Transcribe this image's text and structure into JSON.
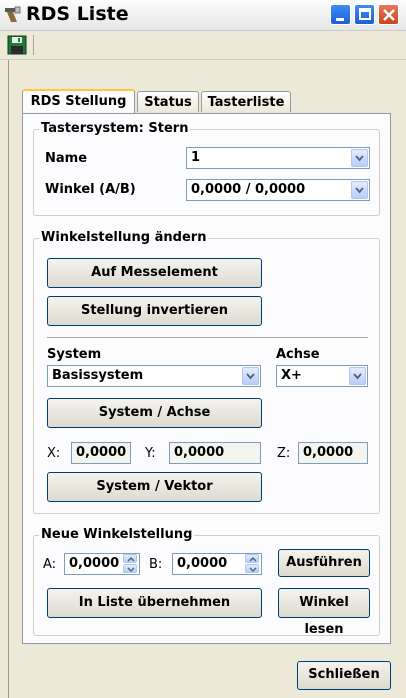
{
  "window": {
    "title": "RDS Liste"
  },
  "tabs": [
    {
      "label": "RDS Stellung",
      "active": true
    },
    {
      "label": "Status",
      "active": false
    },
    {
      "label": "Tasterliste",
      "active": false
    }
  ],
  "tastersystem": {
    "title": "Tastersystem: Stern",
    "name_label": "Name",
    "name_value": "1",
    "winkel_label": "Winkel (A/B)",
    "winkel_value": "0,0000 / 0,0000"
  },
  "winkelstellung": {
    "title": "Winkelstellung ändern",
    "auf_messelement": "Auf Messelement",
    "stellung_invertieren": "Stellung invertieren",
    "system_label": "System",
    "system_value": "Basissystem",
    "achse_label": "Achse",
    "achse_value": "X+",
    "system_achse_button": "System / Achse",
    "x_label": "X:",
    "x_value": "0,0000",
    "y_label": "Y:",
    "y_value": "0,0000",
    "z_label": "Z:",
    "z_value": "0,0000",
    "system_vektor_button": "System / Vektor"
  },
  "neue_winkelstellung": {
    "title": "Neue Winkelstellung",
    "a_label": "A:",
    "a_value": "0,0000",
    "b_label": "B:",
    "b_value": "0,0000",
    "ausfuehren": "Ausführen",
    "in_liste": "In Liste übernehmen",
    "winkel_lesen": "Winkel lesen"
  },
  "footer": {
    "schliessen": "Schließen"
  },
  "icons": {
    "app": "tool-icon",
    "save": "save-icon",
    "minimize": "minimize-icon",
    "maximize": "maximize-icon",
    "close": "close-icon"
  },
  "colors": {
    "titlebar": "#e6e6e6",
    "button_border": "#003c74",
    "tab_highlight": "#ffc83c",
    "close": "#c9441d"
  }
}
